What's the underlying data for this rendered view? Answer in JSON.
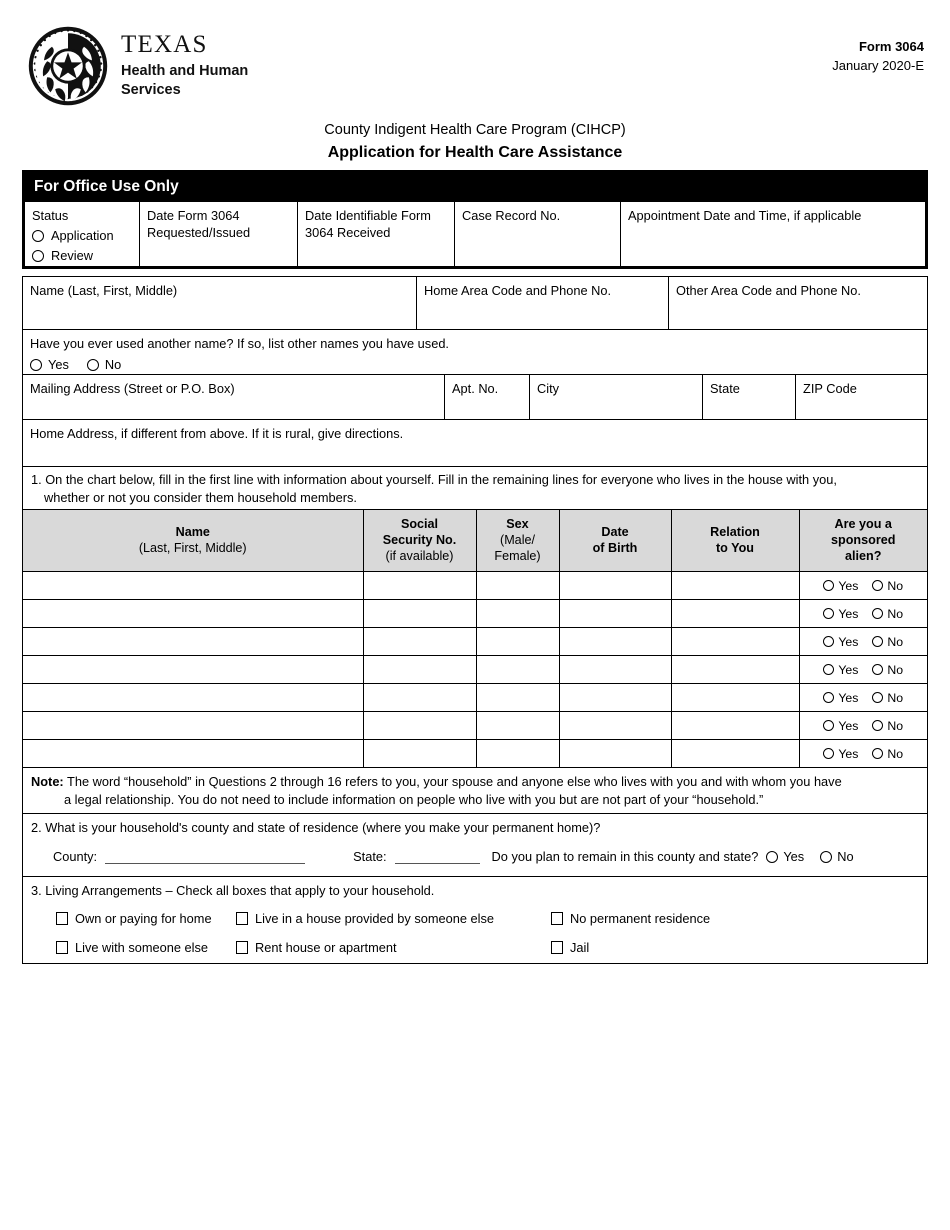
{
  "header": {
    "logo_name": "TEXAS",
    "logo_sub_line1": "Health and Human",
    "logo_sub_line2": "Services",
    "form_number": "Form 3064",
    "form_date": "January 2020-E"
  },
  "titles": {
    "program": "County Indigent Health Care Program (CIHCP)",
    "form_title": "Application for Health Care Assistance"
  },
  "office_use": {
    "bar_label": "For Office Use Only",
    "status_label": "Status",
    "status_options": [
      "Application",
      "Review"
    ],
    "date_requested_line1": "Date Form 3064",
    "date_requested_line2": "Requested/Issued",
    "date_received_line1": "Date Identifiable Form",
    "date_received_line2": "3064 Received",
    "case_record_label": "Case Record No.",
    "appointment_label": "Appointment Date and Time, if applicable"
  },
  "applicant": {
    "name_label": "Name (Last, First, Middle)",
    "home_phone_label": "Home Area Code and Phone No.",
    "other_phone_label": "Other Area Code and Phone No.",
    "other_name_question": "Have you ever used another name? If so, list other names you have used.",
    "other_name_yes": "Yes",
    "other_name_no": "No",
    "mailing_label": "Mailing Address (Street or P.O. Box)",
    "apt_label": "Apt. No.",
    "city_label": "City",
    "state_label": "State",
    "zip_label": "ZIP Code",
    "home_address_label": "Home Address, if different from above. If it is rural, give directions."
  },
  "question1": {
    "line1": "1. On the chart below, fill in the first line with information about yourself. Fill in the remaining lines for everyone who lives in the house with you,",
    "line2": "whether or not you consider them household members.",
    "columns": [
      {
        "main": "Name",
        "sub": "(Last, First, Middle)"
      },
      {
        "main": "Social",
        "main2": "Security No.",
        "sub": "(if available)"
      },
      {
        "main": "Sex",
        "sub": "(Male/",
        "sub2": "Female)"
      },
      {
        "main": "Date",
        "main2": "of Birth",
        "sub": ""
      },
      {
        "main": "Relation",
        "main2": "to You",
        "sub": ""
      },
      {
        "main": "Are you a",
        "main2": "sponsored",
        "main3": "alien?",
        "sub": ""
      }
    ],
    "row_count": 7,
    "alien_yes": "Yes",
    "alien_no": "No"
  },
  "note": {
    "prefix": "Note:",
    "line1": " The word “household” in Questions 2 through 16 refers to you, your spouse and anyone else who lives with you and with whom you have",
    "line2": "a legal relationship. You do not need to include information on people who live with you but are not part of your “household.”"
  },
  "question2": {
    "text": "2. What is your household's county and state of residence (where you make your permanent home)?",
    "county_label": "County:",
    "county_value": "",
    "state_label": "State:",
    "state_value": "",
    "remain_question": "Do you plan to remain in this county and state?",
    "yes": "Yes",
    "no": "No"
  },
  "question3": {
    "text": "3. Living Arrangements – Check all boxes that apply to your household.",
    "options_row1": [
      "Own or paying for home",
      "Live in a house provided by someone else",
      "No permanent residence"
    ],
    "options_row2": [
      "Live with someone else",
      "Rent house or apartment",
      "Jail"
    ]
  },
  "colors": {
    "header_fill": "#d9d9d9",
    "bar_fill": "#000000",
    "border": "#000000"
  }
}
